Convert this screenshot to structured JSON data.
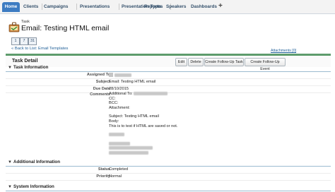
{
  "tabs": [
    "Home",
    "Clients",
    "Campaigns",
    "Presentations",
    "Presentation Types",
    "Reports",
    "Speakers",
    "Dashboards"
  ],
  "plus": "+",
  "record": {
    "type": "Task",
    "title": "Email: Testing HTML email"
  },
  "calendar": [
    "1",
    "7",
    "31"
  ],
  "back_link": "« Back to List: Email Templates",
  "attachments_link": "Attachments [0]",
  "detail": {
    "title": "Task Detail",
    "buttons": [
      "Edit",
      "Delete",
      "Create Follow-Up Task",
      "Create Follow-Up Event"
    ]
  },
  "sections": {
    "task_info": "Task Information",
    "additional": "Additional Information",
    "system": "System Information"
  },
  "fields": {
    "assigned_to_label": "Assigned To",
    "subject_label": "Subject",
    "subject_value": "Email: Testing HTML email",
    "due_date_label": "Due Date",
    "due_date_value": "28/10/2015",
    "comments_label": "Comments",
    "status_label": "Status",
    "status_value": "Completed",
    "priority_label": "Priority",
    "priority_value": "Normal"
  },
  "comment_lines": {
    "additional_to": "Additional To:",
    "cc": "CC:",
    "bcc": "BCC:",
    "attachment": "Attachment:",
    "subject": "Subject: Testing HTML email",
    "body": "Body:",
    "body_text": "This is to test if HTML are saved or not."
  }
}
